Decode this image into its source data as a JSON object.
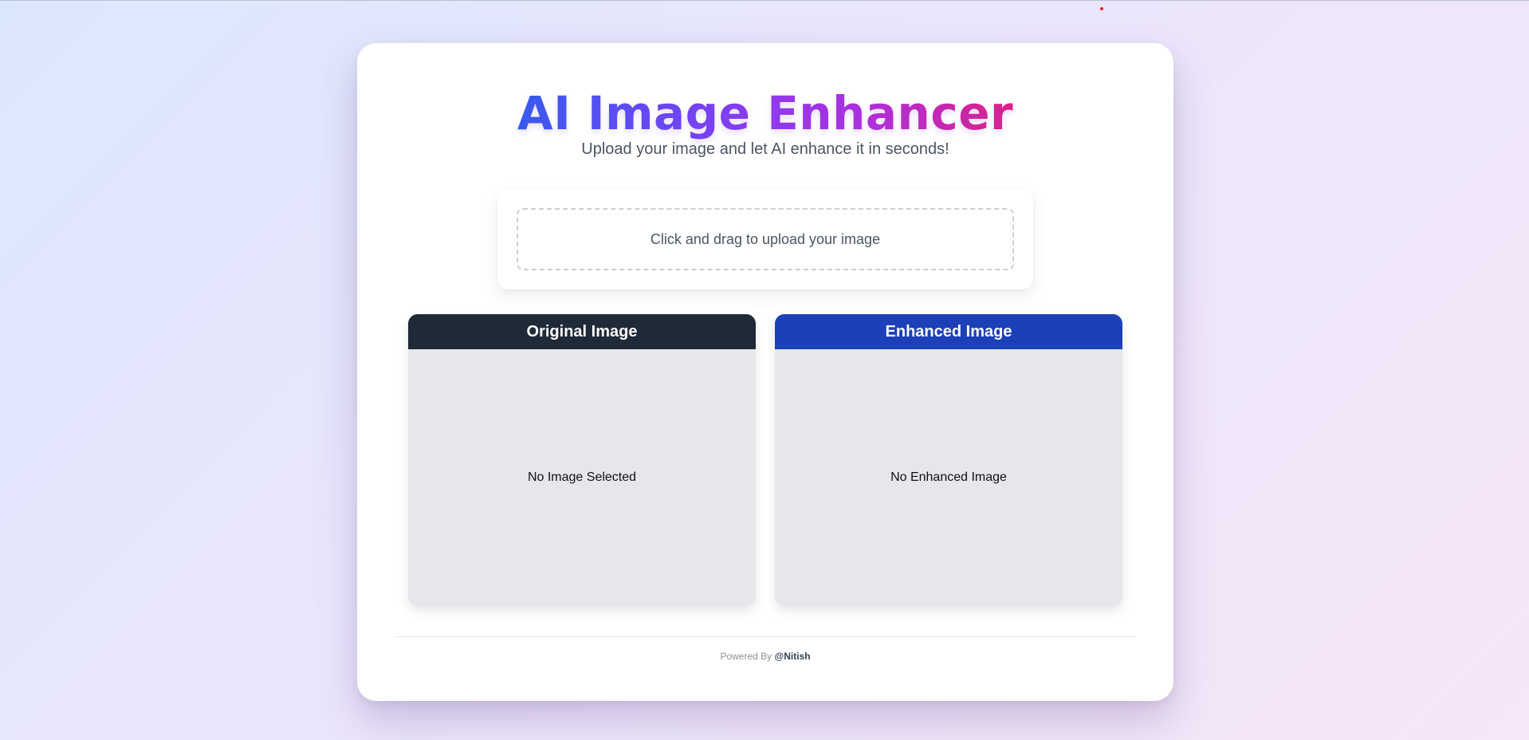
{
  "app": {
    "title": "AI Image Enhancer",
    "subtitle": "Upload your image and let AI enhance it in seconds!"
  },
  "upload": {
    "prompt": "Click and drag to upload your image"
  },
  "panels": {
    "original": {
      "header": "Original Image",
      "placeholder": "No Image Selected",
      "header_color": "#1f2937"
    },
    "enhanced": {
      "header": "Enhanced Image",
      "placeholder": "No Enhanced Image",
      "header_color": "#1d40b8"
    }
  },
  "footer": {
    "prefix": "Powered By",
    "author": "@Nitish"
  },
  "colors": {
    "title_gradient_start": "#2f5cf2",
    "title_gradient_end": "#e61e7e",
    "panel_body": "#e5e7eb"
  }
}
